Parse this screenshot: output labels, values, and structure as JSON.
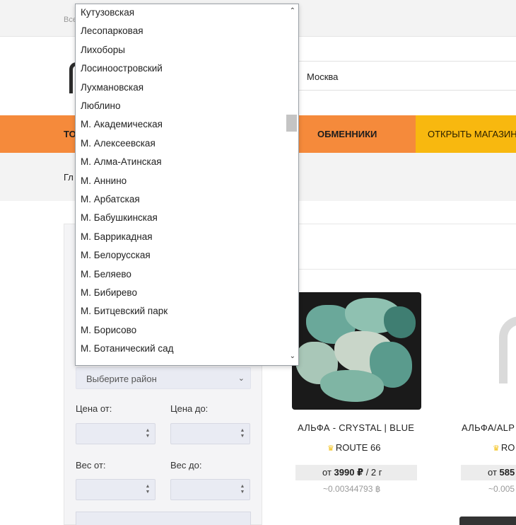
{
  "topbar": {
    "text": "Все"
  },
  "header": {
    "city": "Москва"
  },
  "nav": {
    "left_label": "То",
    "exchangers": "ОБМЕННИКИ",
    "open_shop": "ОТКРЫТЬ МАГАЗИН"
  },
  "breadcrumb": {
    "home": "Гл"
  },
  "filters": {
    "district_placeholder": "Выберите район",
    "price_from": "Цена от:",
    "price_to": "Цена до:",
    "weight_from": "Вес от:",
    "weight_to": "Вес до:"
  },
  "products": [
    {
      "title": "АЛЬФА - CRYSTAL | BLUE",
      "shop": "ROUTE 66",
      "price_prefix": "от ",
      "price": "3990 ₽",
      "price_suffix": " / 2 г",
      "btc": "~0.00344793 ฿"
    },
    {
      "title": "АЛЬФА/ALP",
      "shop": "RO",
      "price_prefix": "от ",
      "price": "585",
      "btc": "~0.005"
    }
  ],
  "dropdown": {
    "items": [
      "Кутузовская",
      "Лесопарковая",
      "Лихоборы",
      "Лосиноостровский",
      "Лухмановская",
      "Люблино",
      "М. Академическая",
      "М. Алексеевская",
      "М. Алма-Атинская",
      "М. Аннино",
      "М. Арбатская",
      "М. Бабушкинская",
      "М. Баррикадная",
      "М. Белорусская",
      "М. Беляево",
      "М. Бибирево",
      "М. Битцевский парк",
      "М. Борисово",
      "М. Ботанический сад"
    ],
    "scroll_up_icon": "chevron-up-icon",
    "scroll_down_icon": "chevron-down-icon"
  }
}
